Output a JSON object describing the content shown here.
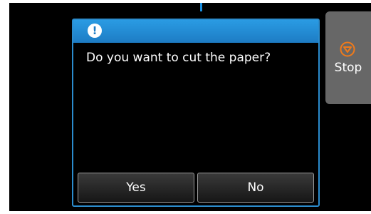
{
  "dialog": {
    "icon": "exclamation-icon",
    "icon_glyph": "!",
    "message": "Do you want to cut the paper?",
    "yes_label": "Yes",
    "no_label": "No"
  },
  "stop": {
    "icon": "stop-icon",
    "label": "Stop"
  },
  "colors": {
    "screen_background": "#000000",
    "dialog_header": "#1d7cc4",
    "dialog_border": "#2b8ccd",
    "stop_button": "#676767",
    "stop_icon": "#f07a1a",
    "indicator": "#1a8fe0"
  }
}
